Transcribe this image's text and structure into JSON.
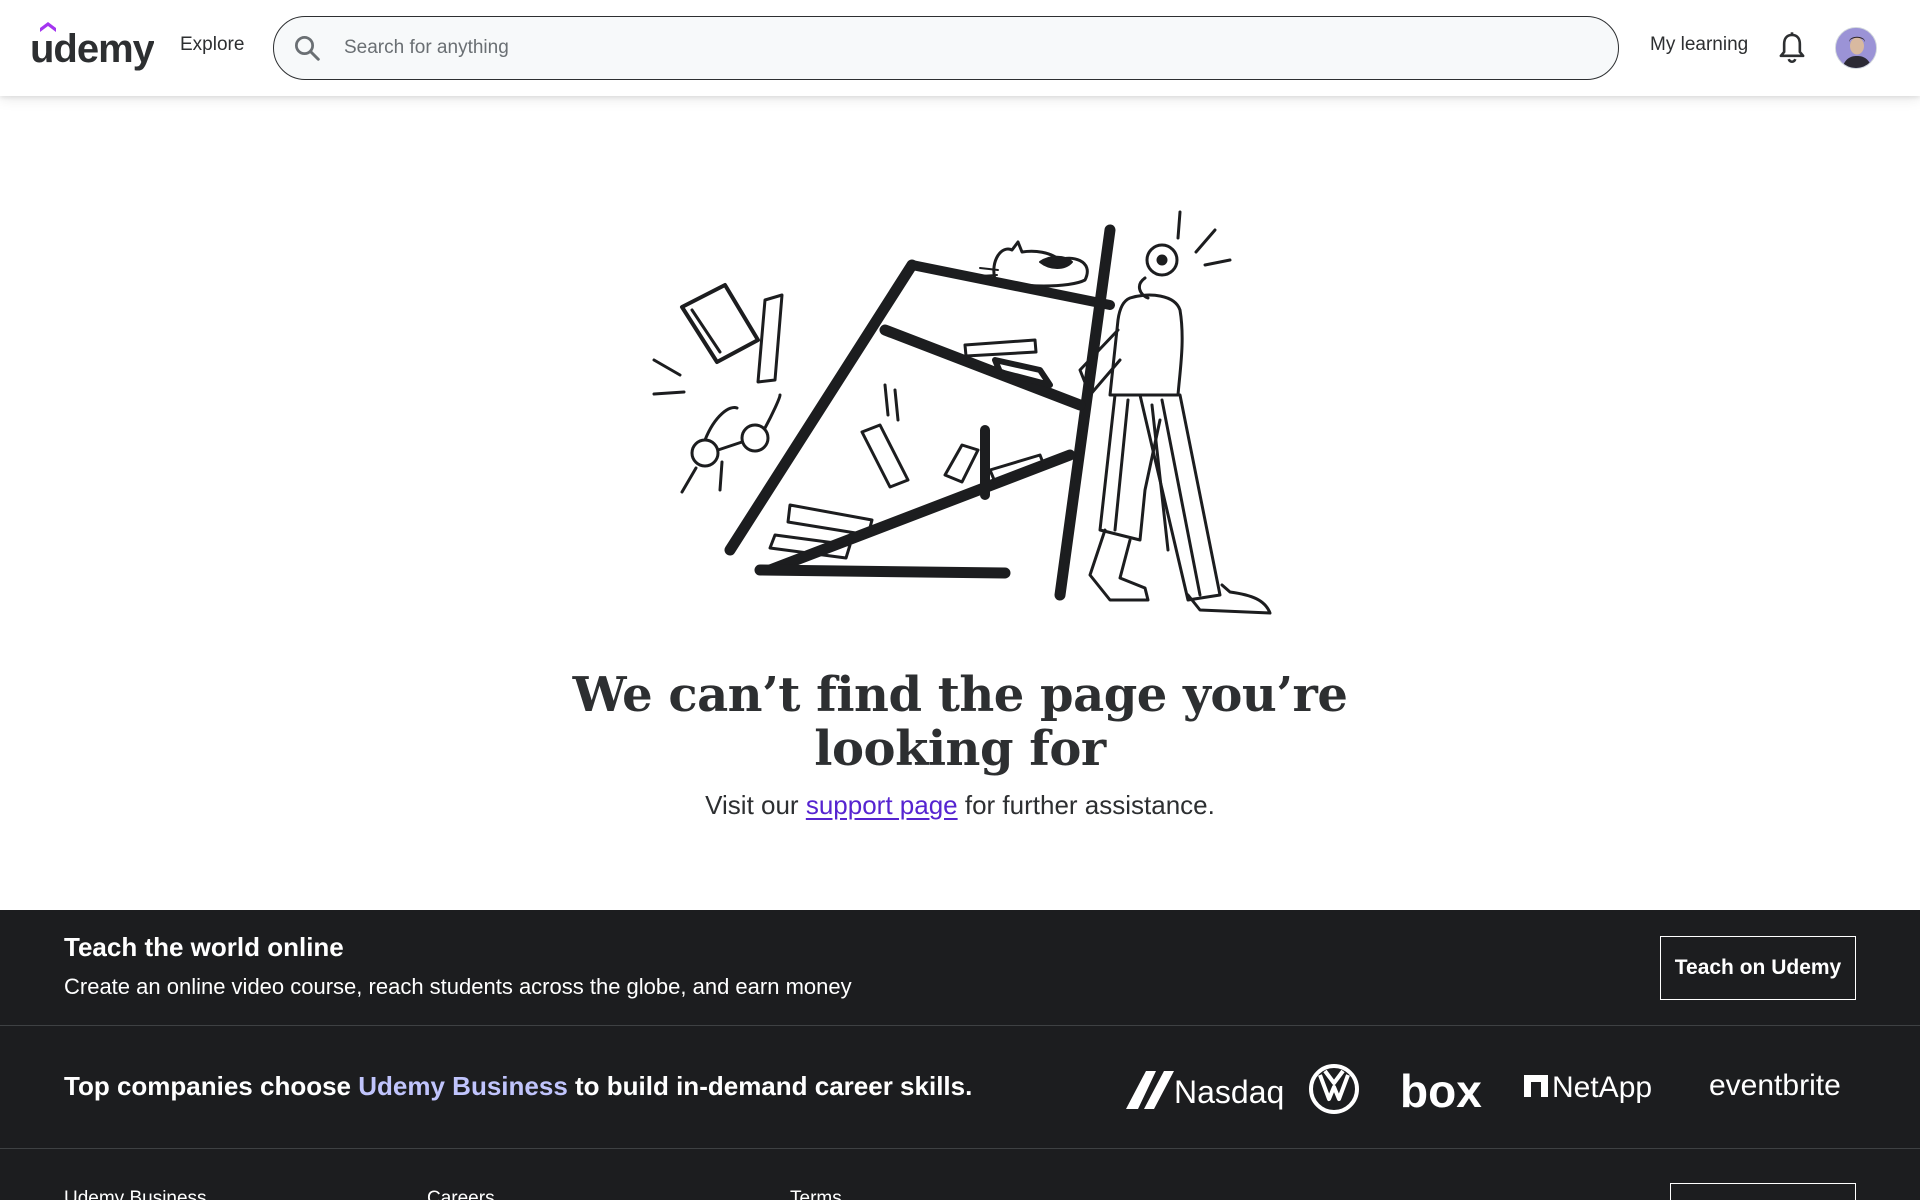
{
  "header": {
    "logo_alt": "udemy",
    "explore_label": "Explore",
    "search_placeholder": "Search for anything",
    "search_value": "",
    "my_learning_label": "My learning"
  },
  "error": {
    "headline": "We can’t find the page you’re looking for",
    "subline_before": "Visit our ",
    "support_link": "support page",
    "subline_after": " for further assistance."
  },
  "footer": {
    "teach_title": "Teach the world online",
    "teach_sub": "Create an online video course, reach students across the globe, and earn money",
    "teach_button": "Teach on Udemy",
    "companies_before": "Top companies choose ",
    "companies_brand": "Udemy Business",
    "companies_after": " to build in-demand career skills.",
    "company_logos": [
      "Nasdaq",
      "Volkswagen",
      "box",
      "NetApp",
      "eventbrite"
    ],
    "links": [
      "Udemy Business",
      "Careers",
      "Terms"
    ]
  },
  "colors": {
    "brand_purple": "#a435f0",
    "link_purple": "#5624d0",
    "footer_bg": "#1c1d1f",
    "business_link": "#c0c4fc"
  },
  "icons": {
    "search": "search-icon",
    "notifications": "bell-icon",
    "avatar": "user-avatar"
  }
}
